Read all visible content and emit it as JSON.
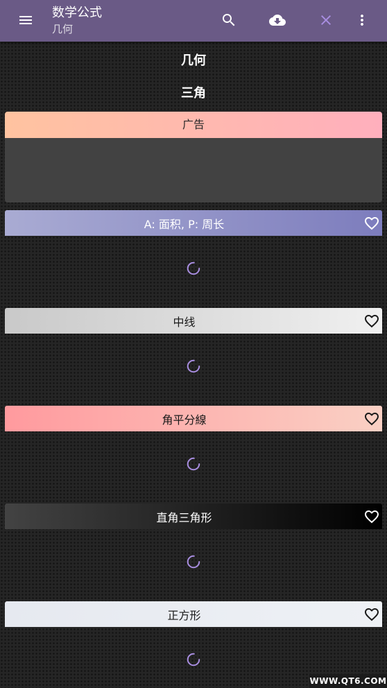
{
  "app_bar": {
    "title": "数学公式",
    "subtitle": "几何",
    "icons": {
      "menu": "menu-icon",
      "search": "search-icon",
      "download": "cloud-download-icon",
      "close": "close-icon",
      "more": "more-vert-icon"
    }
  },
  "page": {
    "section_title": "几何",
    "category_title": "三角"
  },
  "ad": {
    "label": "广告",
    "header_gradient": [
      "#ffc3a0",
      "#ffafbd"
    ]
  },
  "cards": [
    {
      "title": "A: 面积, P: 周长",
      "favorite_icon": "heart-outline-icon",
      "loading": true,
      "header_gradient": [
        "#a9abd3",
        "#7d7dbd"
      ],
      "text_color": "#ffffff"
    },
    {
      "title": "中线",
      "favorite_icon": "heart-outline-icon",
      "loading": true,
      "header_gradient": [
        "#c9c9c9",
        "#f0f0f0"
      ],
      "text_color": "#1a1a1a"
    },
    {
      "title": "角平分線",
      "favorite_icon": "heart-outline-icon",
      "loading": true,
      "header_gradient": [
        "#ff9a9e",
        "#fad0c4"
      ],
      "text_color": "#1a1a1a"
    },
    {
      "title": "直角三角形",
      "favorite_icon": "heart-outline-icon",
      "loading": true,
      "header_gradient": [
        "#434343",
        "#000000"
      ],
      "text_color": "#ffffff"
    },
    {
      "title": "正方形",
      "favorite_icon": "heart-outline-icon",
      "loading": true,
      "header_gradient": [
        "#e6e9f0",
        "#eef1f5"
      ],
      "text_color": "#1a1a1a"
    }
  ],
  "watermark": "WWW.QT6.COM",
  "colors": {
    "app_bar": "#6a5a86",
    "accent": "#a88de0",
    "ad_body": "#424242",
    "background": "#252525"
  }
}
